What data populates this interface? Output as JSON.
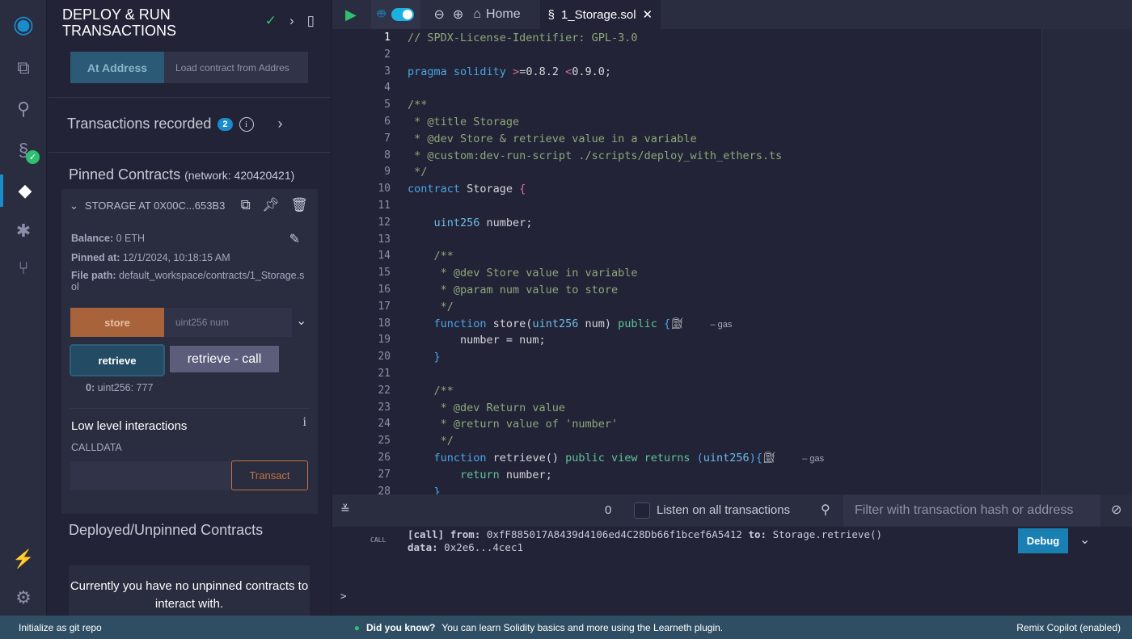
{
  "iconbar": {
    "items": [
      "remix-logo",
      "file-explorer",
      "search",
      "solidity-compiler",
      "deploy-run",
      "debugger",
      "git"
    ],
    "bottom": [
      "plugin-manager",
      "settings"
    ]
  },
  "panel": {
    "title_line1": "DEPLOY & RUN",
    "title_line2": "TRANSACTIONS",
    "at_address": "At Address",
    "load_placeholder": "Load contract from Addres",
    "tx_recorded": "Transactions recorded",
    "tx_count": "2",
    "info": "i",
    "pinned_title": "Pinned Contracts",
    "pinned_network": "(network: 420420421)",
    "contract": {
      "name": "STORAGE AT 0X00C...653B3",
      "balance_label": "Balance:",
      "balance": "0 ETH",
      "pinned_label": "Pinned at:",
      "pinned": "12/1/2024, 10:18:15 AM",
      "path_label": "File path:",
      "path": "default_workspace/contracts/1_Storage.sol",
      "store": "store",
      "store_placeholder": "uint256 num",
      "retrieve": "retrieve",
      "tooltip": "retrieve - call",
      "result_label": "0:",
      "result": "uint256: 777",
      "low_level": "Low level interactions",
      "calldata": "CALLDATA",
      "transact": "Transact"
    },
    "deployed_title": "Deployed/Unpinned Contracts",
    "no_unpinned": "Currently you have no unpinned contracts to interact with."
  },
  "tabs": {
    "home": "Home",
    "file": "1_Storage.sol"
  },
  "code": {
    "active_line": 1,
    "lines": [
      [
        [
          "c",
          "// SPDX-License-Identifier: GPL-3.0"
        ]
      ],
      [],
      [
        [
          "k",
          "pragma solidity "
        ],
        [
          "o",
          ">"
        ],
        [
          "p",
          "=0.8.2 "
        ],
        [
          "o",
          "<"
        ],
        [
          "p",
          "0.9.0;"
        ]
      ],
      [],
      [
        [
          "c",
          "/**"
        ]
      ],
      [
        [
          "c",
          " * @title Storage"
        ]
      ],
      [
        [
          "c",
          " * @dev Store & retrieve value in a variable"
        ]
      ],
      [
        [
          "c",
          " * @custom:dev-run-script ./scripts/deploy_with_ethers.ts"
        ]
      ],
      [
        [
          "c",
          " */"
        ]
      ],
      [
        [
          "k",
          "contract "
        ],
        [
          "p",
          "Storage "
        ],
        [
          "o",
          "{"
        ]
      ],
      [],
      [
        [
          "t",
          "    uint256 "
        ],
        [
          "p",
          "number;"
        ]
      ],
      [],
      [
        [
          "c",
          "    /**"
        ]
      ],
      [
        [
          "c",
          "     * @dev Store value in variable"
        ]
      ],
      [
        [
          "c",
          "     * @param num value to store"
        ]
      ],
      [
        [
          "c",
          "     */"
        ]
      ],
      [
        [
          "k",
          "    function "
        ],
        [
          "p",
          "store("
        ],
        [
          "t",
          "uint256 "
        ],
        [
          "p",
          "num) "
        ],
        [
          "g",
          "public "
        ],
        [
          "k",
          "{"
        ]
      ],
      [
        [
          "p",
          "        number = num;"
        ]
      ],
      [
        [
          "k",
          "    }"
        ]
      ],
      [],
      [
        [
          "c",
          "    /**"
        ]
      ],
      [
        [
          "c",
          "     * @dev Return value"
        ]
      ],
      [
        [
          "c",
          "     * @return value of 'number'"
        ]
      ],
      [
        [
          "c",
          "     */"
        ]
      ],
      [
        [
          "k",
          "    function "
        ],
        [
          "p",
          "retrieve() "
        ],
        [
          "g",
          "public view returns "
        ],
        [
          "k",
          "("
        ],
        [
          "t",
          "uint256"
        ],
        [
          "k",
          "){"
        ]
      ],
      [
        [
          "g",
          "        return "
        ],
        [
          "p",
          "number;"
        ]
      ],
      [
        [
          "k",
          "    }"
        ]
      ]
    ],
    "gas_hints": {
      "18": "– gas",
      "26": "– gas"
    }
  },
  "terminal": {
    "count": "0",
    "listen": "Listen on all transactions",
    "filter_placeholder": "Filter with transaction hash or address",
    "log": {
      "tag": "CALL",
      "call": "[call]",
      "from_label": "from:",
      "from": "0xfF885017A8439d4106ed4C28Db66f1bcef6A5412",
      "to_label": "to:",
      "to": "Storage.retrieve()",
      "data_label": "data:",
      "data": "0x2e6...4cec1",
      "debug": "Debug"
    },
    "prompt": ">"
  },
  "status": {
    "git": "Initialize as git repo",
    "tip_label": "Did you know?",
    "tip": "You can learn Solidity basics and more using the Learneth plugin.",
    "copilot": "Remix Copilot (enabled)"
  },
  "colors": {
    "accent": "#1a8ccb",
    "store_button": "#a8633a",
    "status_bar": "#2f4e63"
  }
}
